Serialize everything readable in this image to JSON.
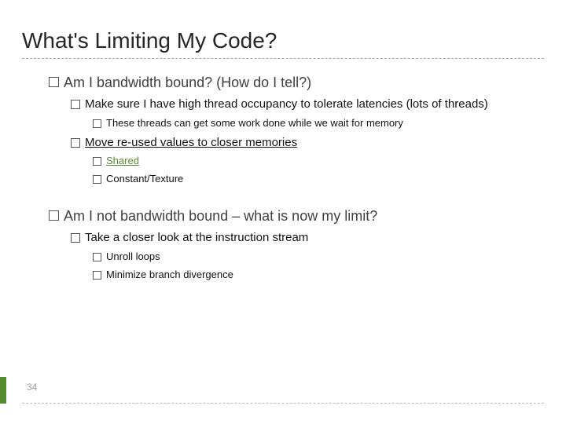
{
  "title": "What's Limiting My Code?",
  "page_number": "34",
  "b1": {
    "text": "Am I bandwidth bound? (How do I tell?)",
    "s1": {
      "text": "Make sure I have high thread occupancy to tolerate latencies (lots of threads)",
      "t1": "These threads can get some work done while we wait for memory"
    },
    "s2": {
      "text": "Move re-used values to closer memories",
      "t1": "Shared",
      "t2": "Constant/Texture"
    }
  },
  "b2": {
    "text": "Am I not bandwidth bound – what is now my limit?",
    "s1": {
      "text": "Take a closer look at the instruction stream",
      "t1": "Unroll loops",
      "t2": "Minimize branch divergence"
    }
  }
}
